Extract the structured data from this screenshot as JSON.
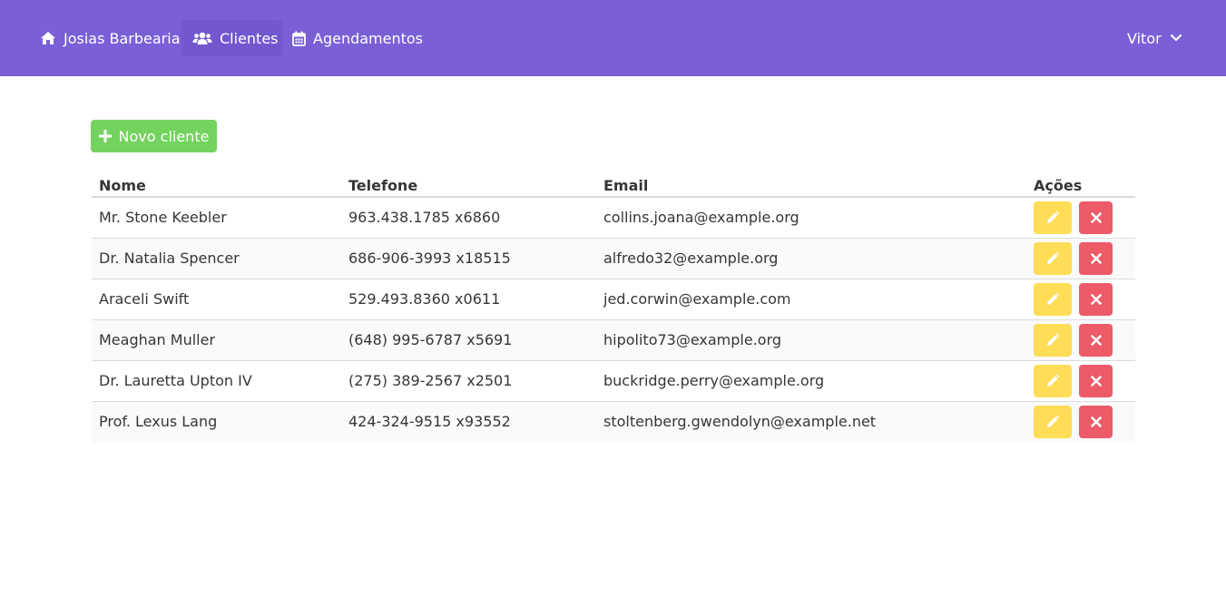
{
  "navbar": {
    "brand": "Josias Barbearia",
    "items": [
      {
        "label": "Clientes",
        "icon": "users-icon",
        "active": true
      },
      {
        "label": "Agendamentos",
        "icon": "calendar-icon",
        "active": false
      }
    ],
    "user": "Vitor"
  },
  "actions": {
    "new_client_label": "Novo cliente"
  },
  "table": {
    "headers": {
      "name": "Nome",
      "phone": "Telefone",
      "email": "Email",
      "actions": "Ações"
    },
    "rows": [
      {
        "name": "Mr. Stone Keebler",
        "phone": "963.438.1785 x6860",
        "email": "collins.joana@example.org"
      },
      {
        "name": "Dr. Natalia Spencer",
        "phone": "686-906-3993 x18515",
        "email": "alfredo32@example.org"
      },
      {
        "name": "Araceli Swift",
        "phone": "529.493.8360 x0611",
        "email": "jed.corwin@example.com"
      },
      {
        "name": "Meaghan Muller",
        "phone": "(648) 995-6787 x5691",
        "email": "hipolito73@example.org"
      },
      {
        "name": "Dr. Lauretta Upton IV",
        "phone": "(275) 389-2567 x2501",
        "email": "buckridge.perry@example.org"
      },
      {
        "name": "Prof. Lexus Lang",
        "phone": "424-324-9515 x93552",
        "email": "stoltenberg.gwendolyn@example.net"
      }
    ]
  },
  "colors": {
    "navbar": "#7a5fd6",
    "success": "#74d35f",
    "warning": "#ffdd57",
    "danger": "#ed5a68"
  }
}
